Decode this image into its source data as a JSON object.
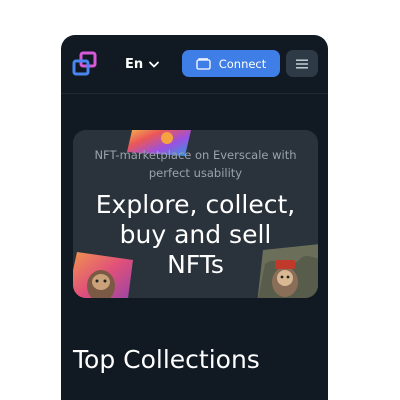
{
  "header": {
    "language": "En",
    "connect_label": "Connect"
  },
  "hero": {
    "subtitle": "NFT-marketplace on Everscale with perfect usability",
    "title": "Explore, collect,\nbuy and sell\nNFTs"
  },
  "sections": {
    "top_collections_title": "Top Collections"
  },
  "colors": {
    "background": "#111a22",
    "accent": "#3f7ee6",
    "hero_card": "#2a333b",
    "menu_button": "#2e3a45"
  },
  "icons": {
    "logo": "marketplace-logo-icon",
    "language_chevron": "chevron-down-icon",
    "wallet": "wallet-icon",
    "menu": "hamburger-menu-icon"
  }
}
